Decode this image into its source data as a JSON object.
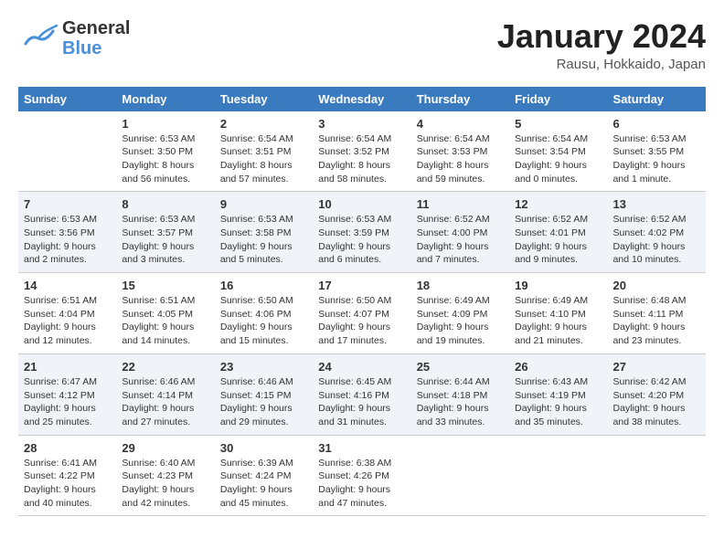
{
  "header": {
    "logo_line1": "General",
    "logo_line2": "Blue",
    "month": "January 2024",
    "location": "Rausu, Hokkaido, Japan"
  },
  "columns": [
    "Sunday",
    "Monday",
    "Tuesday",
    "Wednesday",
    "Thursday",
    "Friday",
    "Saturday"
  ],
  "weeks": [
    [
      {
        "day": "",
        "info": ""
      },
      {
        "day": "1",
        "info": "Sunrise: 6:53 AM\nSunset: 3:50 PM\nDaylight: 8 hours\nand 56 minutes."
      },
      {
        "day": "2",
        "info": "Sunrise: 6:54 AM\nSunset: 3:51 PM\nDaylight: 8 hours\nand 57 minutes."
      },
      {
        "day": "3",
        "info": "Sunrise: 6:54 AM\nSunset: 3:52 PM\nDaylight: 8 hours\nand 58 minutes."
      },
      {
        "day": "4",
        "info": "Sunrise: 6:54 AM\nSunset: 3:53 PM\nDaylight: 8 hours\nand 59 minutes."
      },
      {
        "day": "5",
        "info": "Sunrise: 6:54 AM\nSunset: 3:54 PM\nDaylight: 9 hours\nand 0 minutes."
      },
      {
        "day": "6",
        "info": "Sunrise: 6:53 AM\nSunset: 3:55 PM\nDaylight: 9 hours\nand 1 minute."
      }
    ],
    [
      {
        "day": "7",
        "info": "Sunrise: 6:53 AM\nSunset: 3:56 PM\nDaylight: 9 hours\nand 2 minutes."
      },
      {
        "day": "8",
        "info": "Sunrise: 6:53 AM\nSunset: 3:57 PM\nDaylight: 9 hours\nand 3 minutes."
      },
      {
        "day": "9",
        "info": "Sunrise: 6:53 AM\nSunset: 3:58 PM\nDaylight: 9 hours\nand 5 minutes."
      },
      {
        "day": "10",
        "info": "Sunrise: 6:53 AM\nSunset: 3:59 PM\nDaylight: 9 hours\nand 6 minutes."
      },
      {
        "day": "11",
        "info": "Sunrise: 6:52 AM\nSunset: 4:00 PM\nDaylight: 9 hours\nand 7 minutes."
      },
      {
        "day": "12",
        "info": "Sunrise: 6:52 AM\nSunset: 4:01 PM\nDaylight: 9 hours\nand 9 minutes."
      },
      {
        "day": "13",
        "info": "Sunrise: 6:52 AM\nSunset: 4:02 PM\nDaylight: 9 hours\nand 10 minutes."
      }
    ],
    [
      {
        "day": "14",
        "info": "Sunrise: 6:51 AM\nSunset: 4:04 PM\nDaylight: 9 hours\nand 12 minutes."
      },
      {
        "day": "15",
        "info": "Sunrise: 6:51 AM\nSunset: 4:05 PM\nDaylight: 9 hours\nand 14 minutes."
      },
      {
        "day": "16",
        "info": "Sunrise: 6:50 AM\nSunset: 4:06 PM\nDaylight: 9 hours\nand 15 minutes."
      },
      {
        "day": "17",
        "info": "Sunrise: 6:50 AM\nSunset: 4:07 PM\nDaylight: 9 hours\nand 17 minutes."
      },
      {
        "day": "18",
        "info": "Sunrise: 6:49 AM\nSunset: 4:09 PM\nDaylight: 9 hours\nand 19 minutes."
      },
      {
        "day": "19",
        "info": "Sunrise: 6:49 AM\nSunset: 4:10 PM\nDaylight: 9 hours\nand 21 minutes."
      },
      {
        "day": "20",
        "info": "Sunrise: 6:48 AM\nSunset: 4:11 PM\nDaylight: 9 hours\nand 23 minutes."
      }
    ],
    [
      {
        "day": "21",
        "info": "Sunrise: 6:47 AM\nSunset: 4:12 PM\nDaylight: 9 hours\nand 25 minutes."
      },
      {
        "day": "22",
        "info": "Sunrise: 6:46 AM\nSunset: 4:14 PM\nDaylight: 9 hours\nand 27 minutes."
      },
      {
        "day": "23",
        "info": "Sunrise: 6:46 AM\nSunset: 4:15 PM\nDaylight: 9 hours\nand 29 minutes."
      },
      {
        "day": "24",
        "info": "Sunrise: 6:45 AM\nSunset: 4:16 PM\nDaylight: 9 hours\nand 31 minutes."
      },
      {
        "day": "25",
        "info": "Sunrise: 6:44 AM\nSunset: 4:18 PM\nDaylight: 9 hours\nand 33 minutes."
      },
      {
        "day": "26",
        "info": "Sunrise: 6:43 AM\nSunset: 4:19 PM\nDaylight: 9 hours\nand 35 minutes."
      },
      {
        "day": "27",
        "info": "Sunrise: 6:42 AM\nSunset: 4:20 PM\nDaylight: 9 hours\nand 38 minutes."
      }
    ],
    [
      {
        "day": "28",
        "info": "Sunrise: 6:41 AM\nSunset: 4:22 PM\nDaylight: 9 hours\nand 40 minutes."
      },
      {
        "day": "29",
        "info": "Sunrise: 6:40 AM\nSunset: 4:23 PM\nDaylight: 9 hours\nand 42 minutes."
      },
      {
        "day": "30",
        "info": "Sunrise: 6:39 AM\nSunset: 4:24 PM\nDaylight: 9 hours\nand 45 minutes."
      },
      {
        "day": "31",
        "info": "Sunrise: 6:38 AM\nSunset: 4:26 PM\nDaylight: 9 hours\nand 47 minutes."
      },
      {
        "day": "",
        "info": ""
      },
      {
        "day": "",
        "info": ""
      },
      {
        "day": "",
        "info": ""
      }
    ]
  ]
}
